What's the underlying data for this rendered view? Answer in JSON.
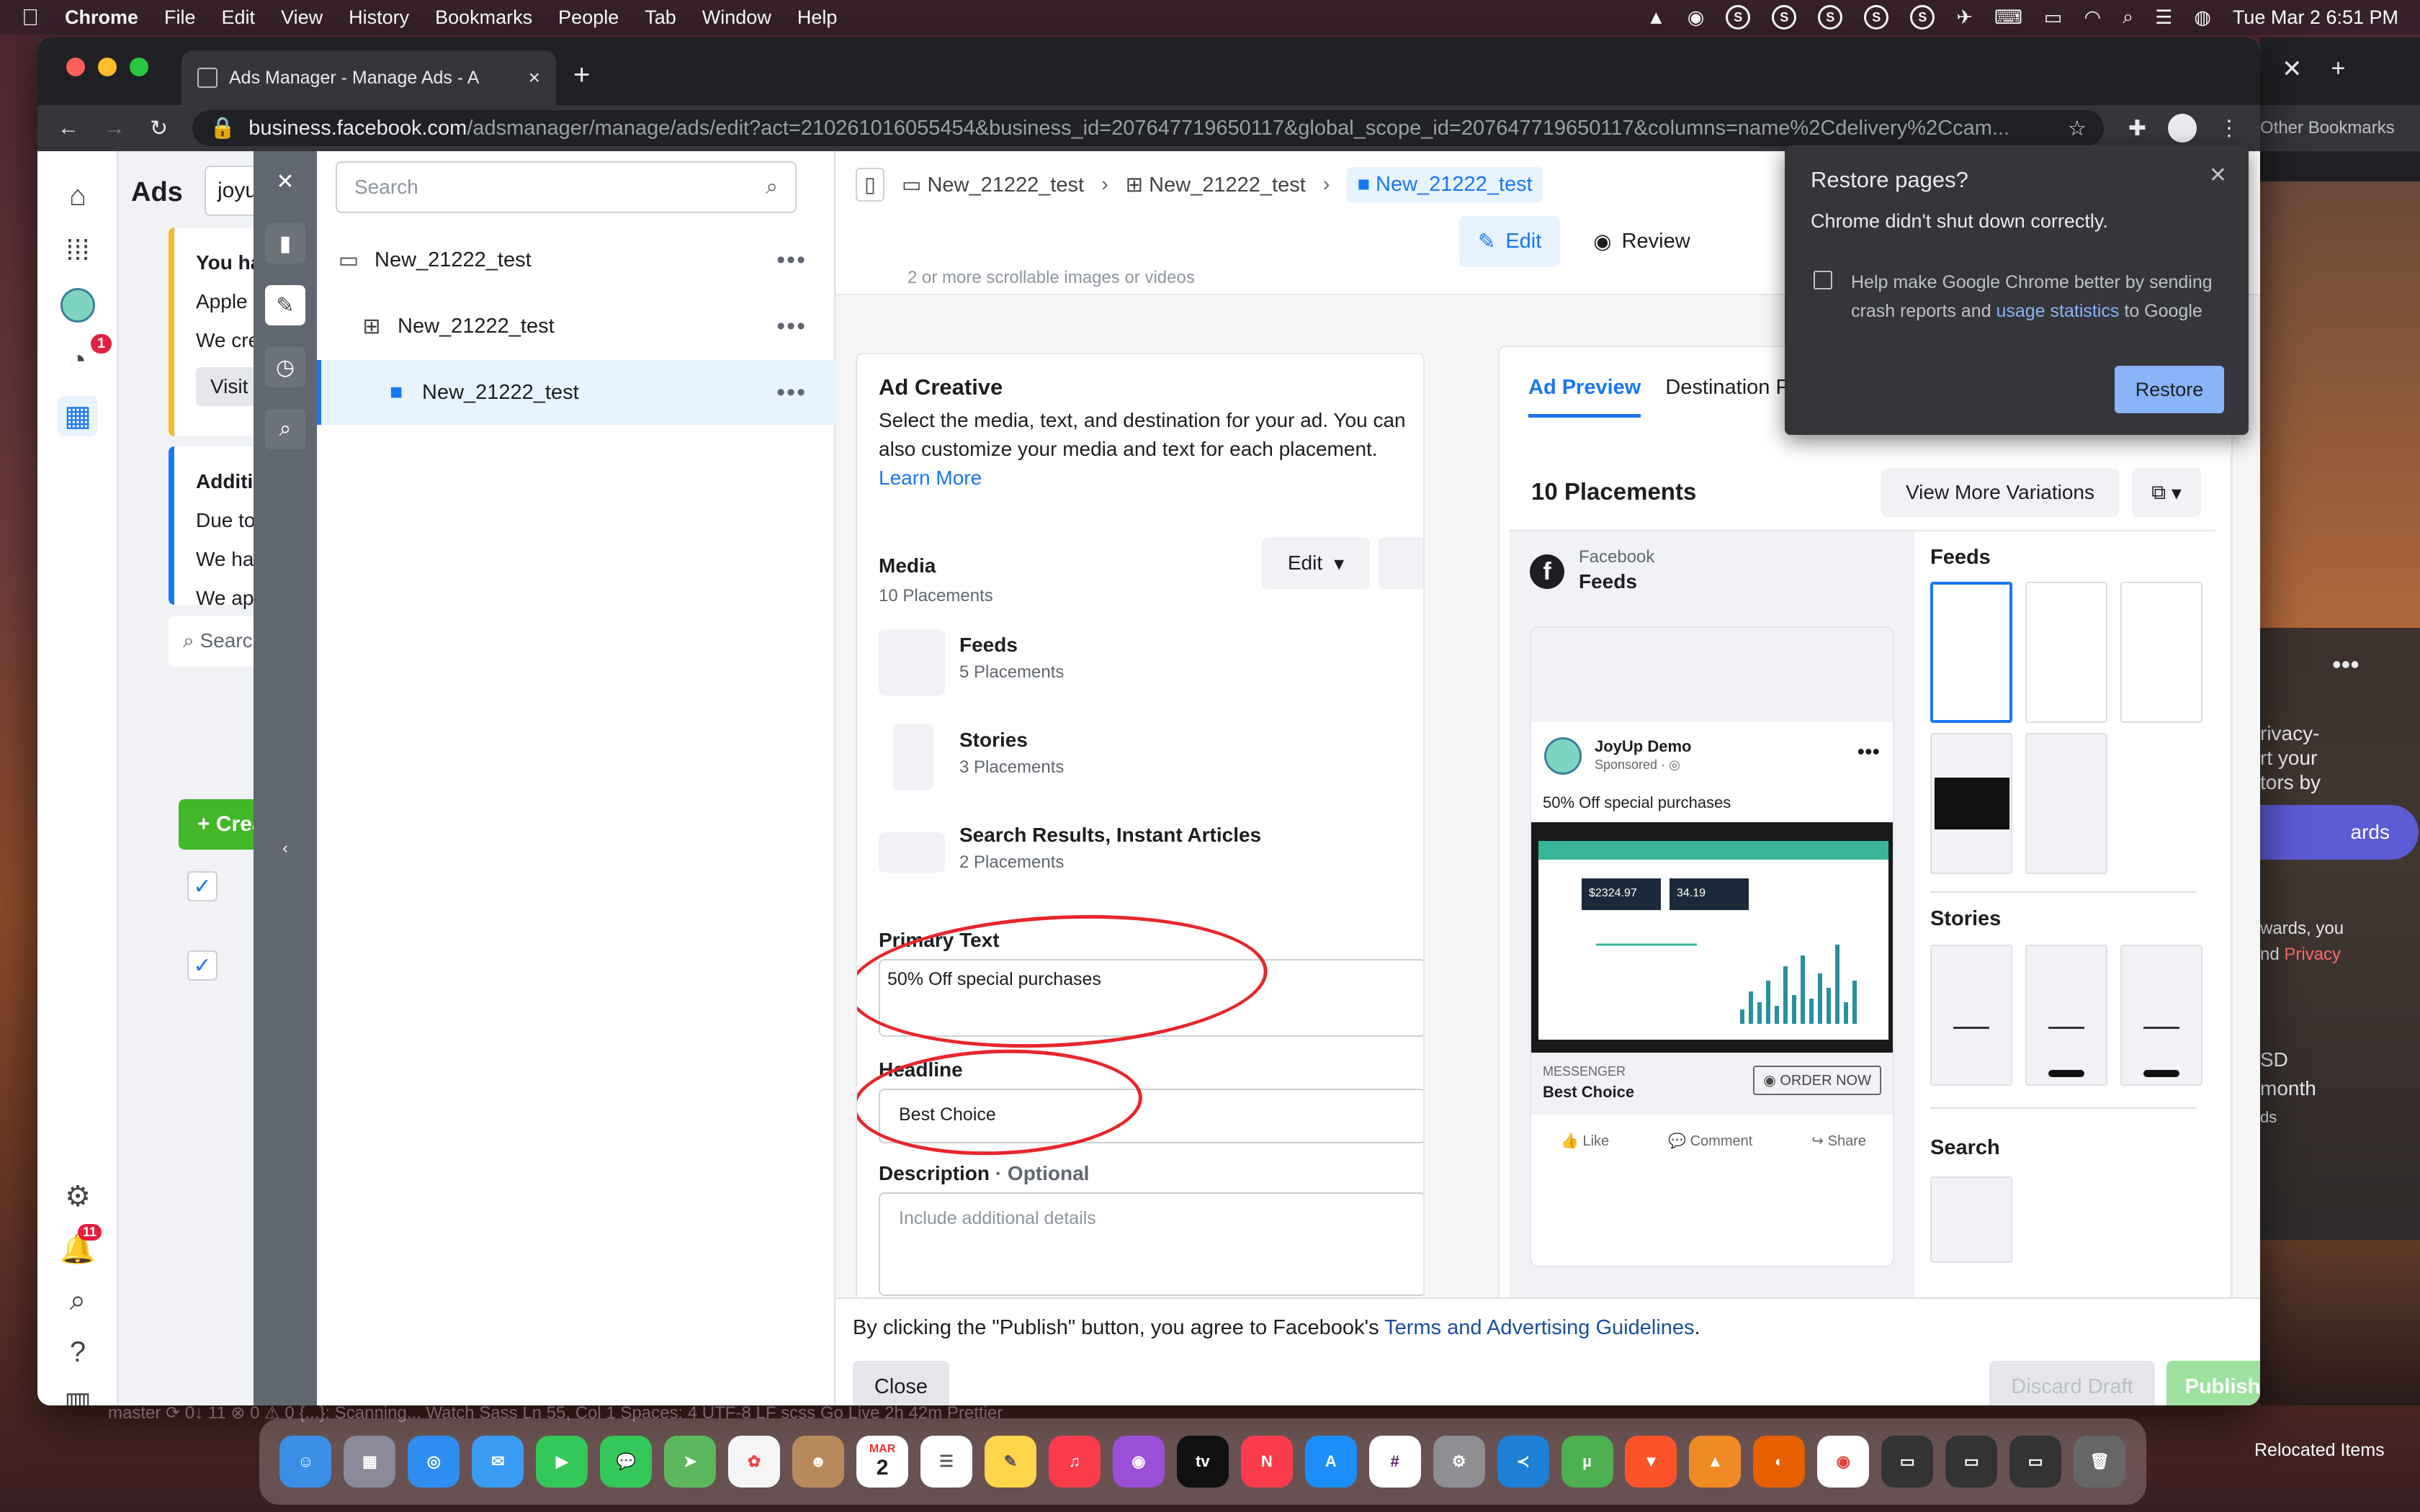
{
  "menubar": {
    "app": "Chrome",
    "items": [
      "File",
      "Edit",
      "View",
      "History",
      "Bookmarks",
      "People",
      "Tab",
      "Window",
      "Help"
    ],
    "clock": "Tue Mar 2  6:51 PM"
  },
  "browser": {
    "tab_title": "Ads Manager - Manage Ads - A",
    "url_host": "business.facebook.com",
    "url_path": "/adsmanager/manage/ads/edit?act=210261016055454&business_id=207647719650117&global_scope_id=207647719650117&columns=name%2Cdelivery%2Ccam...",
    "bookmarks_label": "Other Bookmarks"
  },
  "ads_manager": {
    "header": "Ads",
    "search_value": "joyu",
    "warning_title": "You hav",
    "warning_lines": [
      "Apple r",
      "We crea"
    ],
    "warning_button": "Visit",
    "info_title": "Additio",
    "info_lines": [
      "Due to",
      "We hav",
      "We app"
    ],
    "search_placeholder": "Search",
    "create_label": "Create",
    "notif_badge": "1",
    "bell_badge": "11"
  },
  "tree": {
    "search_placeholder": "Search",
    "nodes": [
      {
        "label": "New_21222_test",
        "level": "campaign"
      },
      {
        "label": "New_21222_test",
        "level": "adset"
      },
      {
        "label": "New_21222_test",
        "level": "ad"
      }
    ]
  },
  "editor": {
    "breadcrumbs": [
      "New_21222_test",
      "New_21222_test",
      "New_21222_test"
    ],
    "edit_label": "Edit",
    "review_label": "Review",
    "cut_text": "2 or more scrollable images or videos",
    "ad_creative": {
      "title": "Ad Creative",
      "description": "Select the media, text, and destination for your ad. You can also customize your media and text for each placement.",
      "learn_more": "Learn More",
      "media_label": "Media",
      "media_count": "10 Placements",
      "media_edit": "Edit",
      "placements": [
        {
          "name": "Feeds",
          "count": "5 Placements"
        },
        {
          "name": "Stories",
          "count": "3 Placements"
        },
        {
          "name": "Search Results, Instant Articles",
          "count": "2 Placements"
        }
      ],
      "primary_text_label": "Primary Text",
      "primary_text_value": "50% Off special purchases",
      "headline_label": "Headline",
      "headline_value": "Best Choice",
      "description_label": "Description",
      "description_optional": " · Optional",
      "description_placeholder": "Include additional details"
    },
    "preview": {
      "tabs": [
        "Ad Preview",
        "Destination Previe"
      ],
      "placements_title": "10 Placements",
      "view_more": "View More Variations",
      "platform": "Facebook",
      "placement": "Feeds",
      "post": {
        "page_name": "JoyUp Demo",
        "sponsored": "Sponsored · ",
        "text": "50% Off special purchases",
        "kpi1": "$2324.97",
        "kpi2": "34.19",
        "cta_source": "MESSENGER",
        "cta_headline": "Best Choice",
        "cta_button": "ORDER NOW",
        "actions": [
          "Like",
          "Comment",
          "Share"
        ]
      },
      "sections": [
        "Feeds",
        "Stories",
        "Search"
      ]
    },
    "footer": {
      "note_prefix": "By clicking the \"Publish\" button, you agree to Facebook's ",
      "note_link": "Terms and Advertising Guidelines",
      "note_suffix": ".",
      "close": "Close",
      "discard": "Discard Draft",
      "publish": "Publish"
    }
  },
  "restore_popup": {
    "title": "Restore pages?",
    "message": "Chrome didn't shut down correctly.",
    "help_prefix": "Help make Google Chrome better by sending crash reports and ",
    "help_link": "usage statistics",
    "help_suffix": " to Google",
    "button": "Restore"
  },
  "right_window": {
    "lines": [
      "rivacy-",
      "rt your",
      "tors by"
    ],
    "pill": "ards",
    "lines2": [
      "wards, you",
      "nd "
    ],
    "privacy": "Privacy",
    "lines3": [
      "SD",
      "month",
      "ds"
    ]
  },
  "statusbar": "master   ⟳ 0↓ 11   ⊗ 0 ⚠ 0   {...}: Scanning...          Watch Sass   Ln 55, Col 1   Spaces: 4   UTF-8   LF   scss   Go Live   2h 42m   Prettier",
  "dock": {
    "relocated": "Relocated Items",
    "calendar_month": "MAR",
    "calendar_day": "2"
  },
  "colors": {
    "accent": "#1877f2",
    "publish_disabled": "#9ee2a0",
    "annotation": "#e8262a"
  }
}
